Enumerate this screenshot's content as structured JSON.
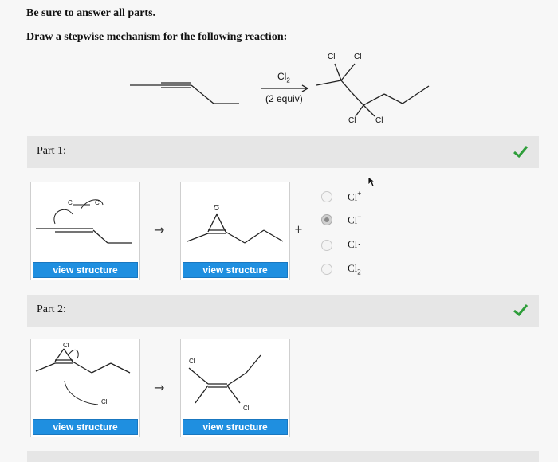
{
  "instructions": {
    "line1": "Be sure to answer all parts.",
    "line2": "Draw a stepwise mechanism for the following reaction:"
  },
  "reaction": {
    "reagent": "Cl",
    "reagent_sub": "2",
    "condition": "(2 equiv)",
    "product_labels": [
      "Cl",
      "Cl",
      "Cl",
      "Cl"
    ]
  },
  "part1": {
    "label": "Part 1:",
    "status_icon": "check-icon",
    "status_color": "#2e9e3a",
    "cards": [
      {
        "button_label": "view structure",
        "atom_label": "Cl",
        "atom_label2": "Cl"
      },
      {
        "button_label": "view structure",
        "atom_label": "Cl"
      }
    ],
    "arrow": "→",
    "plus": "+",
    "options": [
      {
        "text": "Cl",
        "sup": "+",
        "sub": "",
        "selected": false
      },
      {
        "text": "Cl",
        "sup": "−",
        "sub": "",
        "selected": true
      },
      {
        "text": "Cl·",
        "sup": "",
        "sub": "",
        "selected": false
      },
      {
        "text": "Cl",
        "sup": "",
        "sub": "2",
        "selected": false
      }
    ]
  },
  "part2": {
    "label": "Part 2:",
    "status_icon": "check-icon",
    "status_color": "#2e9e3a",
    "cards": [
      {
        "button_label": "view structure",
        "atom_label": "Cl",
        "atom_label2": "Cl"
      },
      {
        "button_label": "view structure",
        "atom_label": "Cl",
        "atom_label2": "Cl"
      }
    ],
    "arrow": "→"
  }
}
